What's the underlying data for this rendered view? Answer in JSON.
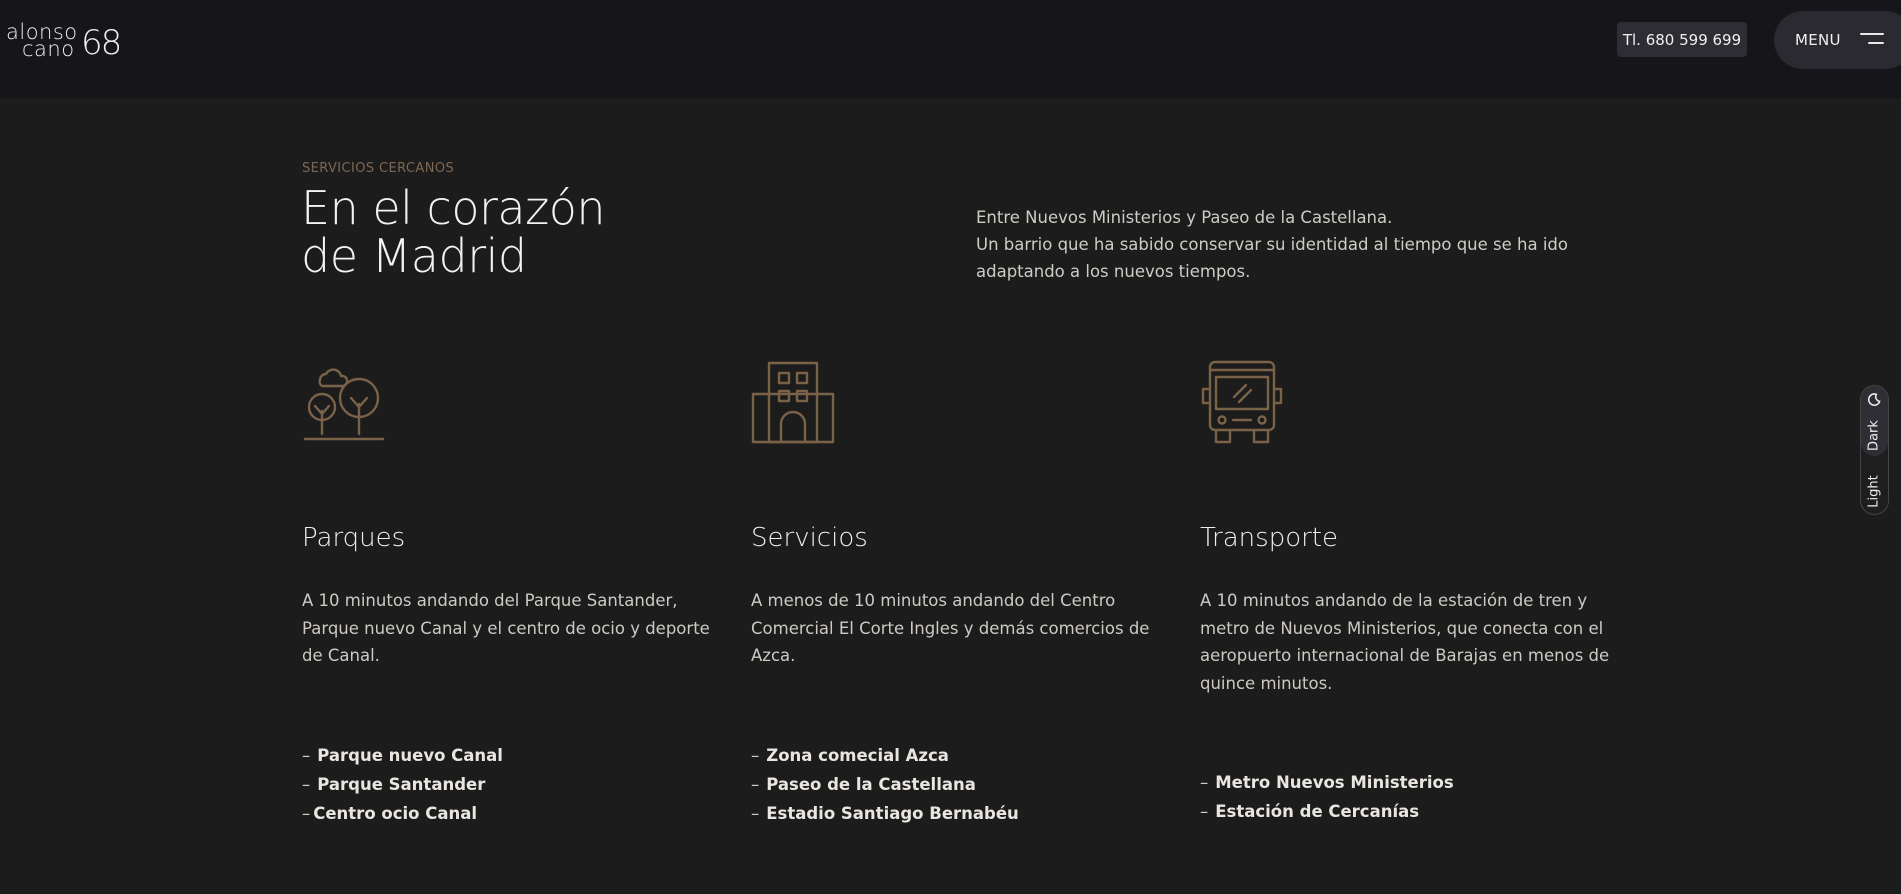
{
  "header": {
    "logo": {
      "word1": "alonso",
      "word2": "cano",
      "number": "68"
    },
    "phone_label": "Tl. 680 599 699",
    "menu_label": "MENU"
  },
  "intro_section": {
    "eyebrow": "SERVICIOS CERCANOS",
    "heading_line1": "En el corazón",
    "heading_line2": "de Madrid",
    "description_line1": "Entre Nuevos Ministerios y Paseo de la Castellana.",
    "description_line2": "Un barrio que ha sabido conservar su identidad al tiempo que se ha ido adaptando a los nuevos tiempos."
  },
  "columns": [
    {
      "icon": "park-trees-icon",
      "title": "Parques",
      "description": "A 10 minutos andando del Parque Santander, Parque nuevo Canal y el centro de ocio y deporte de Canal.",
      "items": [
        {
          "dash": "–",
          "text": "Parque nuevo Canal"
        },
        {
          "dash": "–",
          "text": "Parque Santander"
        },
        {
          "dash": "–",
          "text": "Centro ocio Canal"
        }
      ]
    },
    {
      "icon": "building-icon",
      "title": "Servicios",
      "description": "A menos de 10 minutos andando del Centro Comercial El Corte Ingles y demás comercios de Azca.",
      "items": [
        {
          "dash": "–",
          "text": "Zona comecial Azca"
        },
        {
          "dash": "–",
          "text": "Paseo de la Castellana"
        },
        {
          "dash": "–",
          "text": "Estadio Santiago Bernabéu"
        }
      ]
    },
    {
      "icon": "bus-icon",
      "title": "Transporte",
      "description": "A 10 minutos andando de la estación de tren y metro de Nuevos Ministerios, que conecta con el aeropuerto internacional de Barajas en menos de quince minutos.",
      "items": [
        {
          "dash": "–",
          "text": "Metro Nuevos Ministerios"
        },
        {
          "dash": "–",
          "text": "Estación de Cercanías"
        }
      ]
    }
  ],
  "theme_toggle": {
    "dark_label": "Dark",
    "light_label": "Light",
    "active": "Dark"
  },
  "colors": {
    "background": "#1c1c1c",
    "header_background": "#16161a",
    "accent_brown": "#7d6853",
    "icon_stroke": "#7a6249",
    "text_primary": "#f2f0ec"
  }
}
